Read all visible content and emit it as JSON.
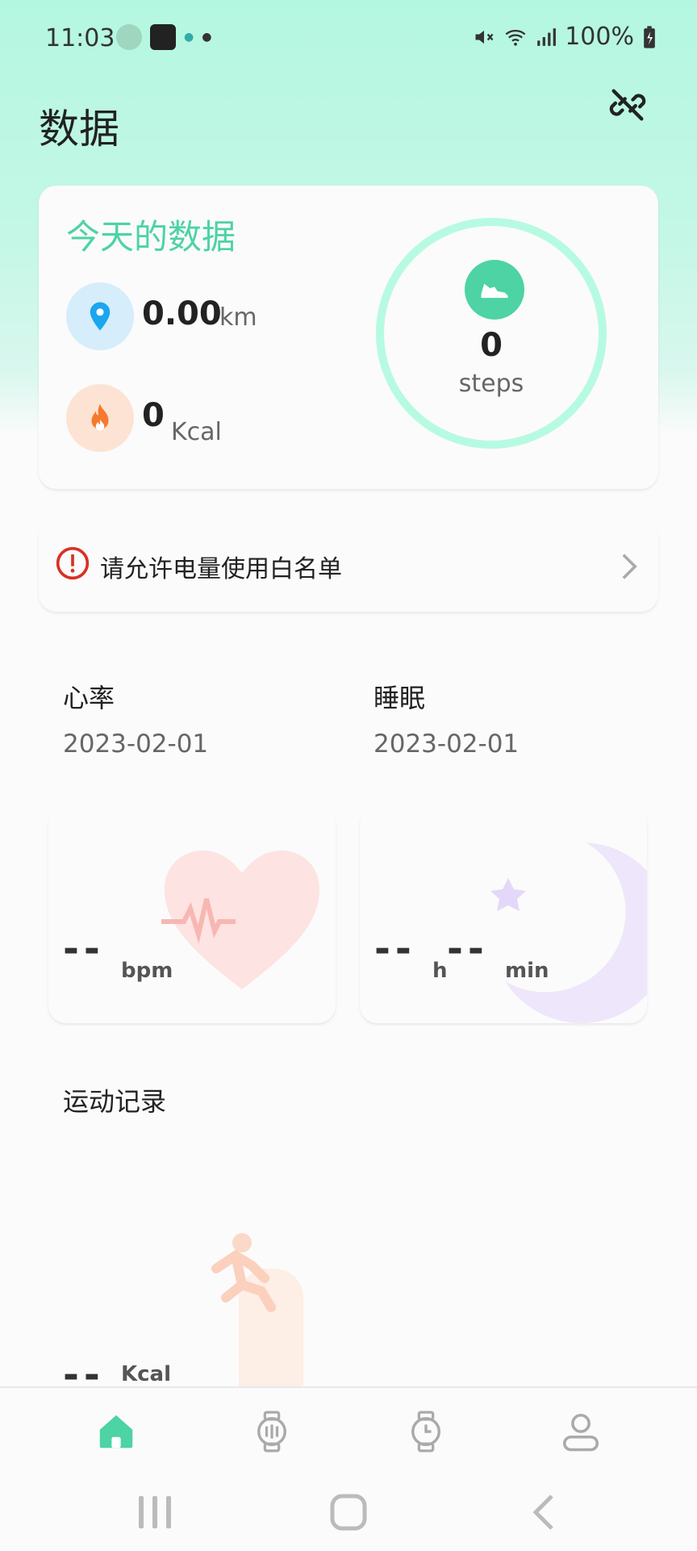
{
  "status_bar": {
    "time": "11:03",
    "battery": "100%"
  },
  "header": {
    "title": "数据"
  },
  "today": {
    "title": "今天的数据",
    "distance": {
      "value": "0.00",
      "unit": "km"
    },
    "calories": {
      "value": "0",
      "unit": "Kcal"
    },
    "steps": {
      "value": "0",
      "label": "steps"
    }
  },
  "notice": {
    "text": "请允许电量使用白名单"
  },
  "heart_rate": {
    "label": "心率",
    "date": "2023-02-01",
    "value": "--",
    "unit": "bpm"
  },
  "sleep": {
    "label": "睡眠",
    "date": "2023-02-01",
    "hours": "--",
    "hours_unit": "h",
    "minutes": "--",
    "minutes_unit": "min"
  },
  "exercise": {
    "label": "运动记录",
    "value": "--",
    "unit": "Kcal"
  },
  "bottom_nav": {
    "tabs": [
      {
        "icon": "home-icon",
        "active": true
      },
      {
        "icon": "watch-settings-icon",
        "active": false
      },
      {
        "icon": "watch-icon",
        "active": false
      },
      {
        "icon": "profile-icon",
        "active": false
      }
    ]
  },
  "colors": {
    "accent": "#4dd3a4",
    "ring": "#b7fae2",
    "warning": "#d93025"
  }
}
